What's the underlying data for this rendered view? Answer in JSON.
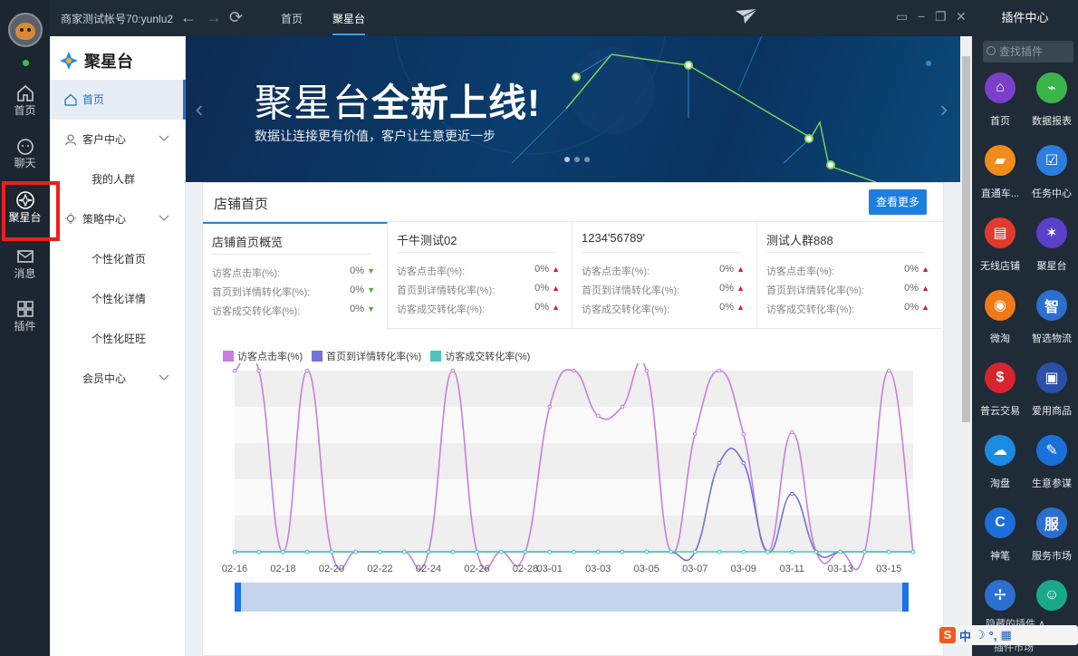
{
  "rail": {
    "items": [
      {
        "label": "首页",
        "icon": "home-icon"
      },
      {
        "label": "聊天",
        "icon": "chat-icon"
      },
      {
        "label": "聚星台",
        "icon": "star-hub-icon"
      },
      {
        "label": "消息",
        "icon": "mail-icon"
      },
      {
        "label": "插件",
        "icon": "grid-icon"
      }
    ]
  },
  "topbar": {
    "account": "商家测试帐号70:yunlu2",
    "tabs": [
      {
        "label": "首页"
      },
      {
        "label": "聚星台"
      }
    ]
  },
  "menu": {
    "brand": "聚星台",
    "items": [
      {
        "label": "首页"
      },
      {
        "label": "客户中心"
      },
      {
        "label": "我的人群"
      },
      {
        "label": "策略中心"
      },
      {
        "label": "个性化首页"
      },
      {
        "label": "个性化详情"
      },
      {
        "label": "个性化旺旺"
      },
      {
        "label": "会员中心"
      }
    ]
  },
  "banner": {
    "headline_light": "聚星台",
    "headline_bold": "全新上线!",
    "subline": "数据让连接更有价值，客户让生意更近一步"
  },
  "store": {
    "title": "店铺首页",
    "more_button": "查看更多",
    "cards": [
      {
        "title": "店铺首页概览",
        "rows": [
          {
            "label": "访客点击率(%):",
            "value": "0%",
            "trend": "down"
          },
          {
            "label": "首页到详情转化率(%):",
            "value": "0%",
            "trend": "down"
          },
          {
            "label": "访客成交转化率(%):",
            "value": "0%",
            "trend": "down"
          }
        ]
      },
      {
        "title": "千牛测试02",
        "rows": [
          {
            "label": "访客点击率(%):",
            "value": "0%",
            "trend": "up"
          },
          {
            "label": "首页到详情转化率(%):",
            "value": "0%",
            "trend": "up"
          },
          {
            "label": "访客成交转化率(%):",
            "value": "0%",
            "trend": "up"
          }
        ]
      },
      {
        "title": "1234'56789'",
        "rows": [
          {
            "label": "访客点击率(%):",
            "value": "0%",
            "trend": "up"
          },
          {
            "label": "首页到详情转化率(%):",
            "value": "0%",
            "trend": "up"
          },
          {
            "label": "访客成交转化率(%):",
            "value": "0%",
            "trend": "up"
          }
        ]
      },
      {
        "title": "测试人群888",
        "rows": [
          {
            "label": "访客点击率(%):",
            "value": "0%",
            "trend": "up"
          },
          {
            "label": "首页到详情转化率(%):",
            "value": "0%",
            "trend": "up"
          },
          {
            "label": "访客成交转化率(%):",
            "value": "0%",
            "trend": "up"
          }
        ]
      }
    ]
  },
  "chart_data": {
    "type": "line",
    "legend_position": "top-left",
    "grid": true,
    "ylim": [
      0,
      100
    ],
    "x": [
      "02-16",
      "02-17",
      "02-18",
      "02-19",
      "02-20",
      "02-21",
      "02-22",
      "02-23",
      "02-24",
      "02-25",
      "02-26",
      "02-27",
      "02-28",
      "03-01",
      "03-02",
      "03-03",
      "03-04",
      "03-05",
      "03-06",
      "03-07",
      "03-08",
      "03-09",
      "03-10",
      "03-11",
      "03-12",
      "03-13",
      "03-14",
      "03-15",
      "03-16"
    ],
    "tick_labels": [
      "02-16",
      "02-18",
      "02-20",
      "02-22",
      "02-24",
      "02-26",
      "02-28",
      "03-01",
      "03-03",
      "03-05",
      "03-07",
      "03-09",
      "03-11",
      "03-13",
      "03-15"
    ],
    "series": [
      {
        "name": "访客点击率(%)",
        "color": "#c77ee0",
        "values": [
          100,
          100,
          0,
          100,
          0,
          0,
          0,
          0,
          0,
          100,
          0,
          0,
          0,
          80,
          100,
          75,
          80,
          100,
          0,
          65,
          100,
          65,
          0,
          66,
          0,
          0,
          0,
          100,
          0
        ]
      },
      {
        "name": "首页到详情转化率(%)",
        "color": "#6f74d6",
        "values": [
          0,
          0,
          0,
          0,
          0,
          0,
          0,
          0,
          0,
          0,
          0,
          0,
          0,
          0,
          0,
          0,
          0,
          0,
          0,
          0,
          49,
          49,
          0,
          32,
          0,
          0,
          0,
          0,
          0
        ]
      },
      {
        "name": "访客成交转化率(%)",
        "color": "#4fc4bd",
        "values": [
          0,
          0,
          0,
          0,
          0,
          0,
          0,
          0,
          0,
          0,
          0,
          0,
          0,
          0,
          0,
          0,
          0,
          0,
          0,
          0,
          0,
          0,
          0,
          0,
          0,
          0,
          0,
          0,
          0
        ]
      }
    ]
  },
  "plugin": {
    "header": "插件中心",
    "search_placeholder": "查找插件",
    "items": [
      {
        "label": "首页",
        "icon": "home-icon",
        "color": "#7b3fc9",
        "glyph": "⌂"
      },
      {
        "label": "数据报表",
        "icon": "chart-icon",
        "color": "#39b54a",
        "glyph": "⌁"
      },
      {
        "label": "直通车...",
        "icon": "car-icon",
        "color": "#f08c1a",
        "glyph": "▰"
      },
      {
        "label": "任务中心",
        "icon": "calendar-check-icon",
        "color": "#2b7de0",
        "glyph": "☑"
      },
      {
        "label": "无线店铺",
        "icon": "store-icon",
        "color": "#e03a2e",
        "glyph": "▤"
      },
      {
        "label": "聚星台",
        "icon": "star-hub-icon",
        "color": "#5a3fc9",
        "glyph": "✶"
      },
      {
        "label": "微淘",
        "icon": "wifi-icon",
        "color": "#f07a1a",
        "glyph": "◉"
      },
      {
        "label": "智选物流",
        "icon": "logistics-icon",
        "color": "#2b6fd0",
        "glyph": "智"
      },
      {
        "label": "普云交易",
        "icon": "money-icon",
        "color": "#d8242e",
        "glyph": "$"
      },
      {
        "label": "爱用商品",
        "icon": "shirt-icon",
        "color": "#2b4fa8",
        "glyph": "▣"
      },
      {
        "label": "淘盘",
        "icon": "cloud-icon",
        "color": "#1a8be0",
        "glyph": "☁"
      },
      {
        "label": "生意参谋",
        "icon": "compass-icon",
        "color": "#1a6fd8",
        "glyph": "✎"
      },
      {
        "label": "神笔",
        "icon": "pen-icon",
        "color": "#1a6fd8",
        "glyph": "C"
      },
      {
        "label": "服务市场",
        "icon": "service-icon",
        "color": "#2b6fd0",
        "glyph": "服"
      },
      {
        "label": "",
        "icon": "pinwheel-icon",
        "color": "#2b6fd0",
        "glyph": "✢"
      },
      {
        "label": "",
        "icon": "person-icon",
        "color": "#18a98a",
        "glyph": "☺"
      }
    ],
    "hidden_label": "隐藏的插件 ∧",
    "market_label": "插件市场"
  }
}
